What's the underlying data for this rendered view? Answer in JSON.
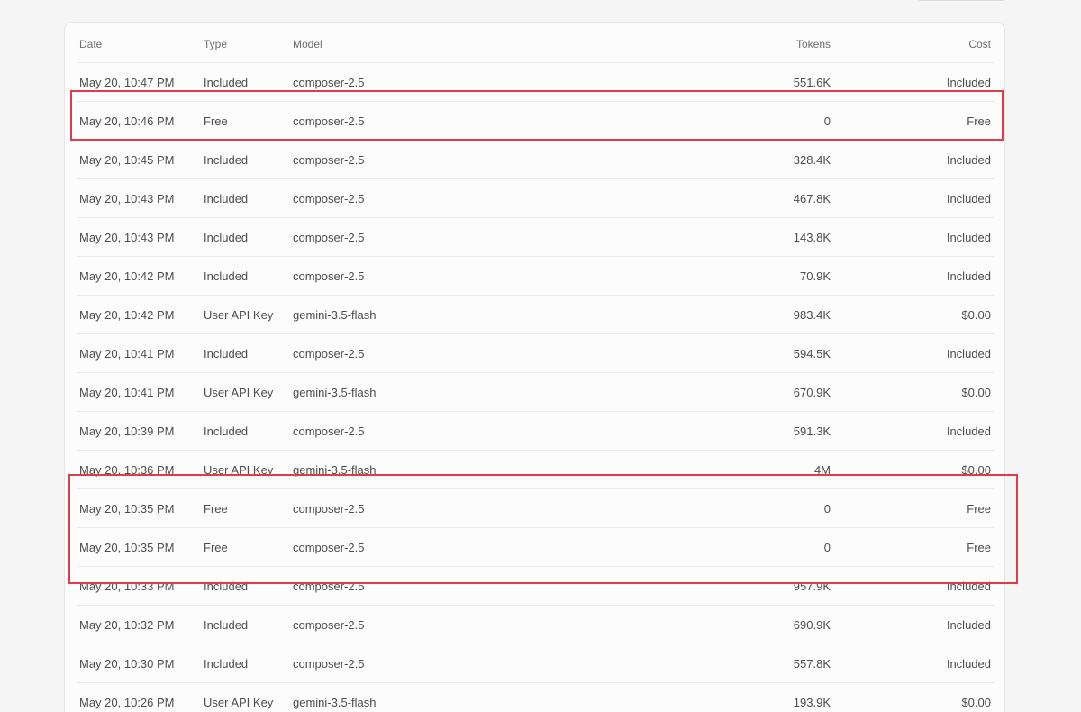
{
  "usage_table": {
    "columns": {
      "date": "Date",
      "type": "Type",
      "model": "Model",
      "tokens": "Tokens",
      "cost": "Cost"
    },
    "rows": [
      {
        "date": "May 20, 10:47 PM",
        "type": "Included",
        "model": "composer-2.5",
        "tokens": "551.6K",
        "cost": "Included"
      },
      {
        "date": "May 20, 10:46 PM",
        "type": "Free",
        "model": "composer-2.5",
        "tokens": "0",
        "cost": "Free"
      },
      {
        "date": "May 20, 10:45 PM",
        "type": "Included",
        "model": "composer-2.5",
        "tokens": "328.4K",
        "cost": "Included"
      },
      {
        "date": "May 20, 10:43 PM",
        "type": "Included",
        "model": "composer-2.5",
        "tokens": "467.8K",
        "cost": "Included"
      },
      {
        "date": "May 20, 10:43 PM",
        "type": "Included",
        "model": "composer-2.5",
        "tokens": "143.8K",
        "cost": "Included"
      },
      {
        "date": "May 20, 10:42 PM",
        "type": "Included",
        "model": "composer-2.5",
        "tokens": "70.9K",
        "cost": "Included"
      },
      {
        "date": "May 20, 10:42 PM",
        "type": "User API Key",
        "model": "gemini-3.5-flash",
        "tokens": "983.4K",
        "cost": "$0.00"
      },
      {
        "date": "May 20, 10:41 PM",
        "type": "Included",
        "model": "composer-2.5",
        "tokens": "594.5K",
        "cost": "Included"
      },
      {
        "date": "May 20, 10:41 PM",
        "type": "User API Key",
        "model": "gemini-3.5-flash",
        "tokens": "670.9K",
        "cost": "$0.00"
      },
      {
        "date": "May 20, 10:39 PM",
        "type": "Included",
        "model": "composer-2.5",
        "tokens": "591.3K",
        "cost": "Included"
      },
      {
        "date": "May 20, 10:36 PM",
        "type": "User API Key",
        "model": "gemini-3.5-flash",
        "tokens": "4M",
        "cost": "$0.00"
      },
      {
        "date": "May 20, 10:35 PM",
        "type": "Free",
        "model": "composer-2.5",
        "tokens": "0",
        "cost": "Free"
      },
      {
        "date": "May 20, 10:35 PM",
        "type": "Free",
        "model": "composer-2.5",
        "tokens": "0",
        "cost": "Free"
      },
      {
        "date": "May 20, 10:33 PM",
        "type": "Included",
        "model": "composer-2.5",
        "tokens": "957.9K",
        "cost": "Included"
      },
      {
        "date": "May 20, 10:32 PM",
        "type": "Included",
        "model": "composer-2.5",
        "tokens": "690.9K",
        "cost": "Included"
      },
      {
        "date": "May 20, 10:30 PM",
        "type": "Included",
        "model": "composer-2.5",
        "tokens": "557.8K",
        "cost": "Included"
      },
      {
        "date": "May 20, 10:26 PM",
        "type": "User API Key",
        "model": "gemini-3.5-flash",
        "tokens": "193.9K",
        "cost": "$0.00"
      }
    ]
  },
  "highlight_color": "#e23a4b"
}
